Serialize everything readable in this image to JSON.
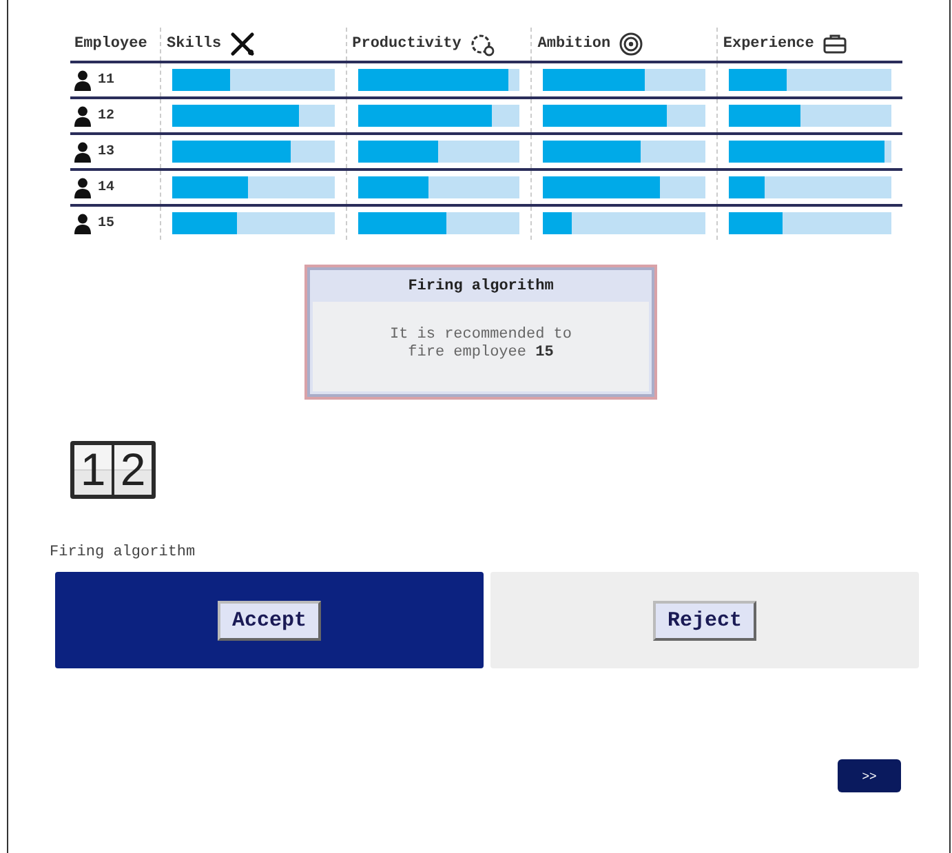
{
  "table": {
    "columns": [
      {
        "label": "Employee",
        "kind": "none"
      },
      {
        "label": "Skills",
        "kind": "tools"
      },
      {
        "label": "Productivity",
        "kind": "gear"
      },
      {
        "label": "Ambition",
        "kind": "target"
      },
      {
        "label": "Experience",
        "kind": "briefcase"
      }
    ],
    "rows": [
      {
        "employee": "11",
        "bars": [
          {
            "level": 0.36
          },
          {
            "level": 0.93
          },
          {
            "level": 0.63
          },
          {
            "level": 0.36
          }
        ]
      },
      {
        "employee": "12",
        "bars": [
          {
            "level": 0.78
          },
          {
            "level": 0.83
          },
          {
            "level": 0.76
          },
          {
            "level": 0.44
          }
        ]
      },
      {
        "employee": "13",
        "bars": [
          {
            "level": 0.73
          },
          {
            "level": 0.5
          },
          {
            "level": 0.6
          },
          {
            "level": 0.96
          }
        ]
      },
      {
        "employee": "14",
        "bars": [
          {
            "level": 0.47
          },
          {
            "level": 0.44
          },
          {
            "level": 0.72
          },
          {
            "level": 0.22
          }
        ]
      },
      {
        "employee": "15",
        "bars": [
          {
            "level": 0.4
          },
          {
            "level": 0.55
          },
          {
            "level": 0.18
          },
          {
            "level": 0.33
          }
        ]
      }
    ]
  },
  "dialog": {
    "title": "Firing algorithm",
    "message": "It is recommended to fire employee **15**"
  },
  "counter": {
    "digits": [
      "1",
      "2"
    ]
  },
  "choice": {
    "label": "Firing algorithm",
    "options": [
      {
        "label": "Accept",
        "selected": true
      },
      {
        "label": "Reject",
        "selected": false
      }
    ]
  },
  "next_button": ">>"
}
